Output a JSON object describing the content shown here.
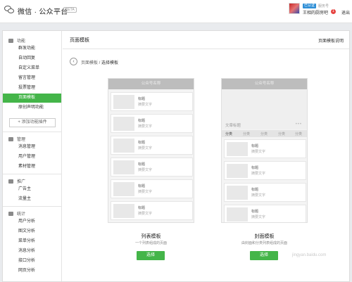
{
  "app": {
    "brand": "微信 · 公众平台",
    "beta": "BETA"
  },
  "account": {
    "tag": "已认证",
    "tag2": "服务号",
    "name": "王相的厨房吧",
    "count": "1",
    "logout": "退出"
  },
  "sidebar": {
    "sections": [
      {
        "title": "功能",
        "icon": "grid-icon"
      },
      {
        "title": "管理",
        "icon": "folder-icon"
      },
      {
        "title": "推广",
        "icon": "megaphone-icon"
      },
      {
        "title": "统计",
        "icon": "chart-icon"
      }
    ],
    "function_items": [
      "群发功能",
      "自动回复",
      "自定义菜单",
      "留言管理",
      "投票管理",
      "页面模板",
      "原创声明功能"
    ],
    "add_plugin": "+ 添加功能插件",
    "manage_items": [
      "消息管理",
      "用户管理",
      "素材管理"
    ],
    "promo_items": [
      "广告主",
      "流量主"
    ],
    "stats_items": [
      "用户分析",
      "图文分析",
      "菜单分析",
      "消息分析",
      "接口分析",
      "网页分析"
    ]
  },
  "main": {
    "title": "页面模板",
    "help": "页面模板说明",
    "breadcrumb": {
      "root": "页面模板",
      "sep": " / ",
      "current": "选择模板"
    }
  },
  "templates": [
    {
      "header": "公众号名称",
      "rows": [
        {
          "title": "标题",
          "sub": "摘要文字"
        },
        {
          "title": "标题",
          "sub": "摘要文字"
        },
        {
          "title": "标题",
          "sub": "摘要文字"
        },
        {
          "title": "标题",
          "sub": "摘要文字"
        },
        {
          "title": "标题",
          "sub": "摘要文字"
        },
        {
          "title": "标题",
          "sub": "摘要文字"
        }
      ],
      "name": "列表模板",
      "desc": "一个列表组成的页面",
      "button": "选择"
    },
    {
      "header": "公众号名称",
      "cover_title": "文章标题",
      "dots": "•••",
      "tabs": [
        "分类",
        "分类",
        "分类",
        "分类",
        "分类"
      ],
      "rows": [
        {
          "title": "标题",
          "sub": "摘要文字"
        },
        {
          "title": "标题",
          "sub": "摘要文字"
        },
        {
          "title": "标题",
          "sub": "摘要文字"
        },
        {
          "title": "标题",
          "sub": "摘要文字"
        }
      ],
      "name": "封面模板",
      "desc": "由封面和分类列表组成的页面",
      "button": "选择"
    }
  ],
  "watermark": "jingyan.baidu.com",
  "colors": {
    "accent": "#44b549",
    "topbar_bg": "#ffffff",
    "page_bg": "#e9ebee"
  }
}
